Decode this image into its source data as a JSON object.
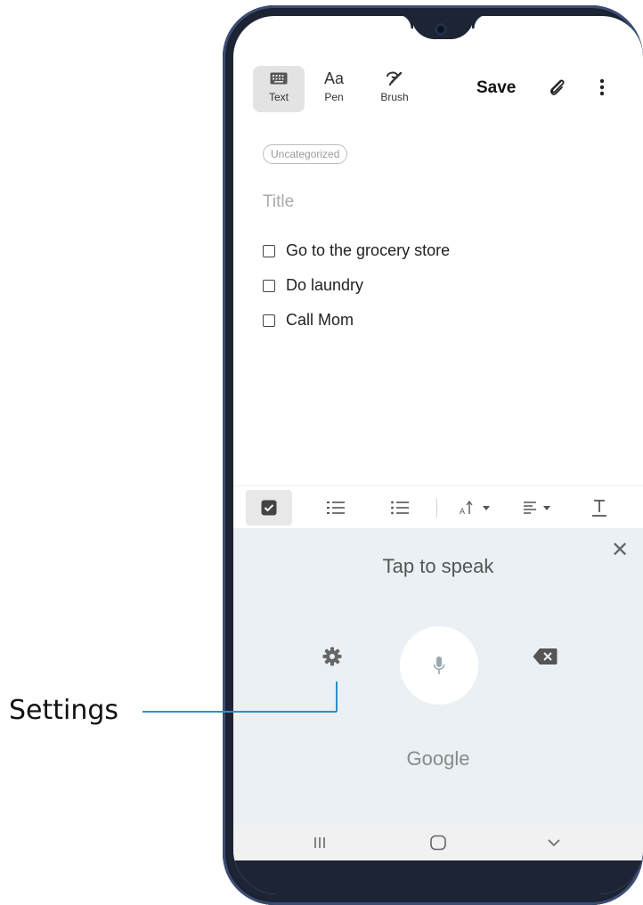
{
  "toolbar": {
    "text_label": "Text",
    "pen_label": "Pen",
    "pen_glyph": "Aa",
    "brush_label": "Brush",
    "save_label": "Save"
  },
  "note": {
    "category": "Uncategorized",
    "title_placeholder": "Title",
    "items": [
      {
        "text": "Go to the grocery store",
        "checked": false
      },
      {
        "text": "Do laundry",
        "checked": false
      },
      {
        "text": "Call Mom",
        "checked": false
      }
    ]
  },
  "voice": {
    "prompt": "Tap to speak",
    "provider": "Google"
  },
  "callout": {
    "label": "Settings"
  },
  "colors": {
    "accent": "#2a8fd1",
    "panel_bg": "#eaf0f3",
    "frame": "#1d2535"
  }
}
